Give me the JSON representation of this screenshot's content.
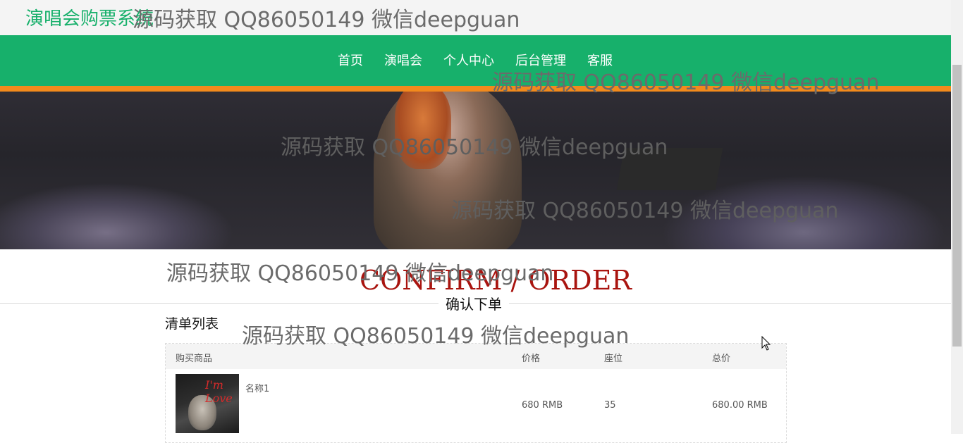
{
  "site": {
    "title": "演唱会购票系统"
  },
  "nav": {
    "items": [
      {
        "label": "首页"
      },
      {
        "label": "演唱会"
      },
      {
        "label": "个人中心"
      },
      {
        "label": "后台管理"
      },
      {
        "label": "客服"
      }
    ]
  },
  "watermark": {
    "text": "源码获取 QQ86050149 微信deepguan"
  },
  "section": {
    "title_en": "CONFIRM / ORDER",
    "title_cn": "确认下单"
  },
  "order": {
    "list_heading": "清单列表",
    "columns": [
      "购买商品",
      "价格",
      "座位",
      "总价"
    ],
    "rows": [
      {
        "name": "名称1",
        "price": "680 RMB",
        "seat": "35",
        "total": "680.00 RMB",
        "image_caption": "I'm Love"
      }
    ]
  },
  "colors": {
    "brand_green": "#17b06b",
    "accent_orange": "#f28a1c",
    "title_red": "#a9140f"
  }
}
